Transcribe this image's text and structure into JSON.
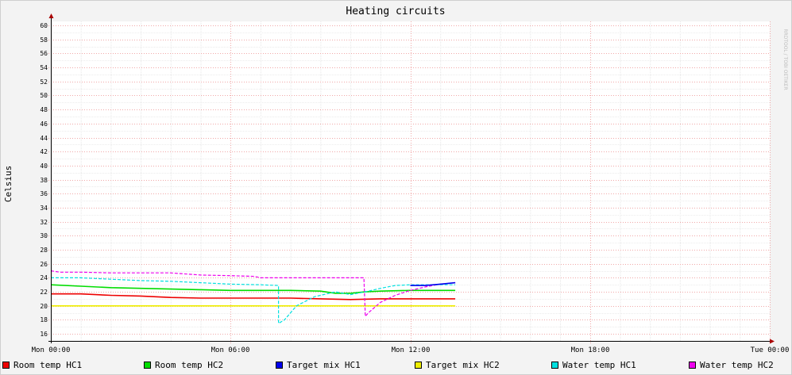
{
  "chart_data": {
    "type": "line",
    "title": "Heating circuits",
    "ylabel": "Celsius",
    "xlabel": "",
    "watermark": "RRDTOOL / TOBI OETIKER",
    "xlim": [
      0,
      24
    ],
    "ylim": [
      15,
      60
    ],
    "y_ticks": [
      16,
      18,
      20,
      22,
      24,
      26,
      28,
      30,
      32,
      34,
      36,
      38,
      40,
      42,
      44,
      46,
      48,
      50,
      52,
      54,
      56,
      58,
      60
    ],
    "x_ticks": [
      {
        "x": 0,
        "label": "Mon 00:00"
      },
      {
        "x": 6,
        "label": "Mon 06:00"
      },
      {
        "x": 12,
        "label": "Mon 12:00"
      },
      {
        "x": 18,
        "label": "Mon 18:00"
      },
      {
        "x": 24,
        "label": "Tue 00:00"
      }
    ],
    "grid": true,
    "legend_position": "bottom",
    "series": [
      {
        "name": "Room temp HC1",
        "color": "#ee0000",
        "dashed": false,
        "x": [
          0,
          1,
          2,
          3,
          4,
          5,
          6,
          7,
          8,
          9,
          10,
          11,
          12,
          13,
          13.5
        ],
        "y": [
          21.7,
          21.7,
          21.5,
          21.4,
          21.2,
          21.1,
          21.1,
          21.1,
          21.1,
          21.0,
          20.9,
          21.0,
          21.0,
          21.0,
          21.0
        ]
      },
      {
        "name": "Room temp HC2",
        "color": "#00dd00",
        "dashed": false,
        "x": [
          0,
          1,
          2,
          3,
          4,
          5,
          6,
          7,
          8,
          9,
          9.5,
          10,
          10.5,
          11,
          12,
          13,
          13.5
        ],
        "y": [
          23.0,
          22.8,
          22.6,
          22.5,
          22.4,
          22.3,
          22.2,
          22.2,
          22.2,
          22.1,
          21.8,
          21.8,
          22.0,
          22.1,
          22.2,
          22.2,
          22.2
        ]
      },
      {
        "name": "Target mix HC1",
        "color": "#0000ee",
        "dashed": false,
        "x": [
          12,
          12.5,
          13,
          13.5
        ],
        "y": [
          22.9,
          22.9,
          23.1,
          23.3
        ]
      },
      {
        "name": "Target mix HC2",
        "color": "#eeee00",
        "dashed": false,
        "x": [
          0,
          13.5
        ],
        "y": [
          20.0,
          20.0
        ]
      },
      {
        "name": "Water temp HC1",
        "color": "#00e0e0",
        "dashed": true,
        "x": [
          0,
          1,
          2,
          3,
          4,
          5,
          6,
          7,
          7.6,
          7.6,
          7.8,
          8.2,
          8.8,
          9.5,
          10,
          10.5,
          11,
          11.5,
          12,
          13,
          13.5
        ],
        "y": [
          24.0,
          24.0,
          23.8,
          23.6,
          23.5,
          23.3,
          23.1,
          23.0,
          22.9,
          17.5,
          18.0,
          20.0,
          21.3,
          22.0,
          21.6,
          22.0,
          22.5,
          22.9,
          23.0,
          23.0,
          23.0
        ]
      },
      {
        "name": "Water temp HC2",
        "color": "#ee00ee",
        "dashed": true,
        "x": [
          0,
          0.3,
          1,
          2,
          3,
          4,
          5,
          6,
          6.8,
          7,
          8,
          9,
          10,
          10.45,
          10.5,
          10.6,
          11,
          11.5,
          12,
          12.5,
          13,
          13.5
        ],
        "y": [
          25.0,
          24.8,
          24.8,
          24.7,
          24.7,
          24.7,
          24.4,
          24.3,
          24.2,
          24.0,
          24.0,
          24.0,
          24.0,
          24.0,
          18.5,
          19.0,
          20.5,
          21.5,
          22.2,
          22.7,
          23.1,
          23.3
        ]
      }
    ]
  }
}
